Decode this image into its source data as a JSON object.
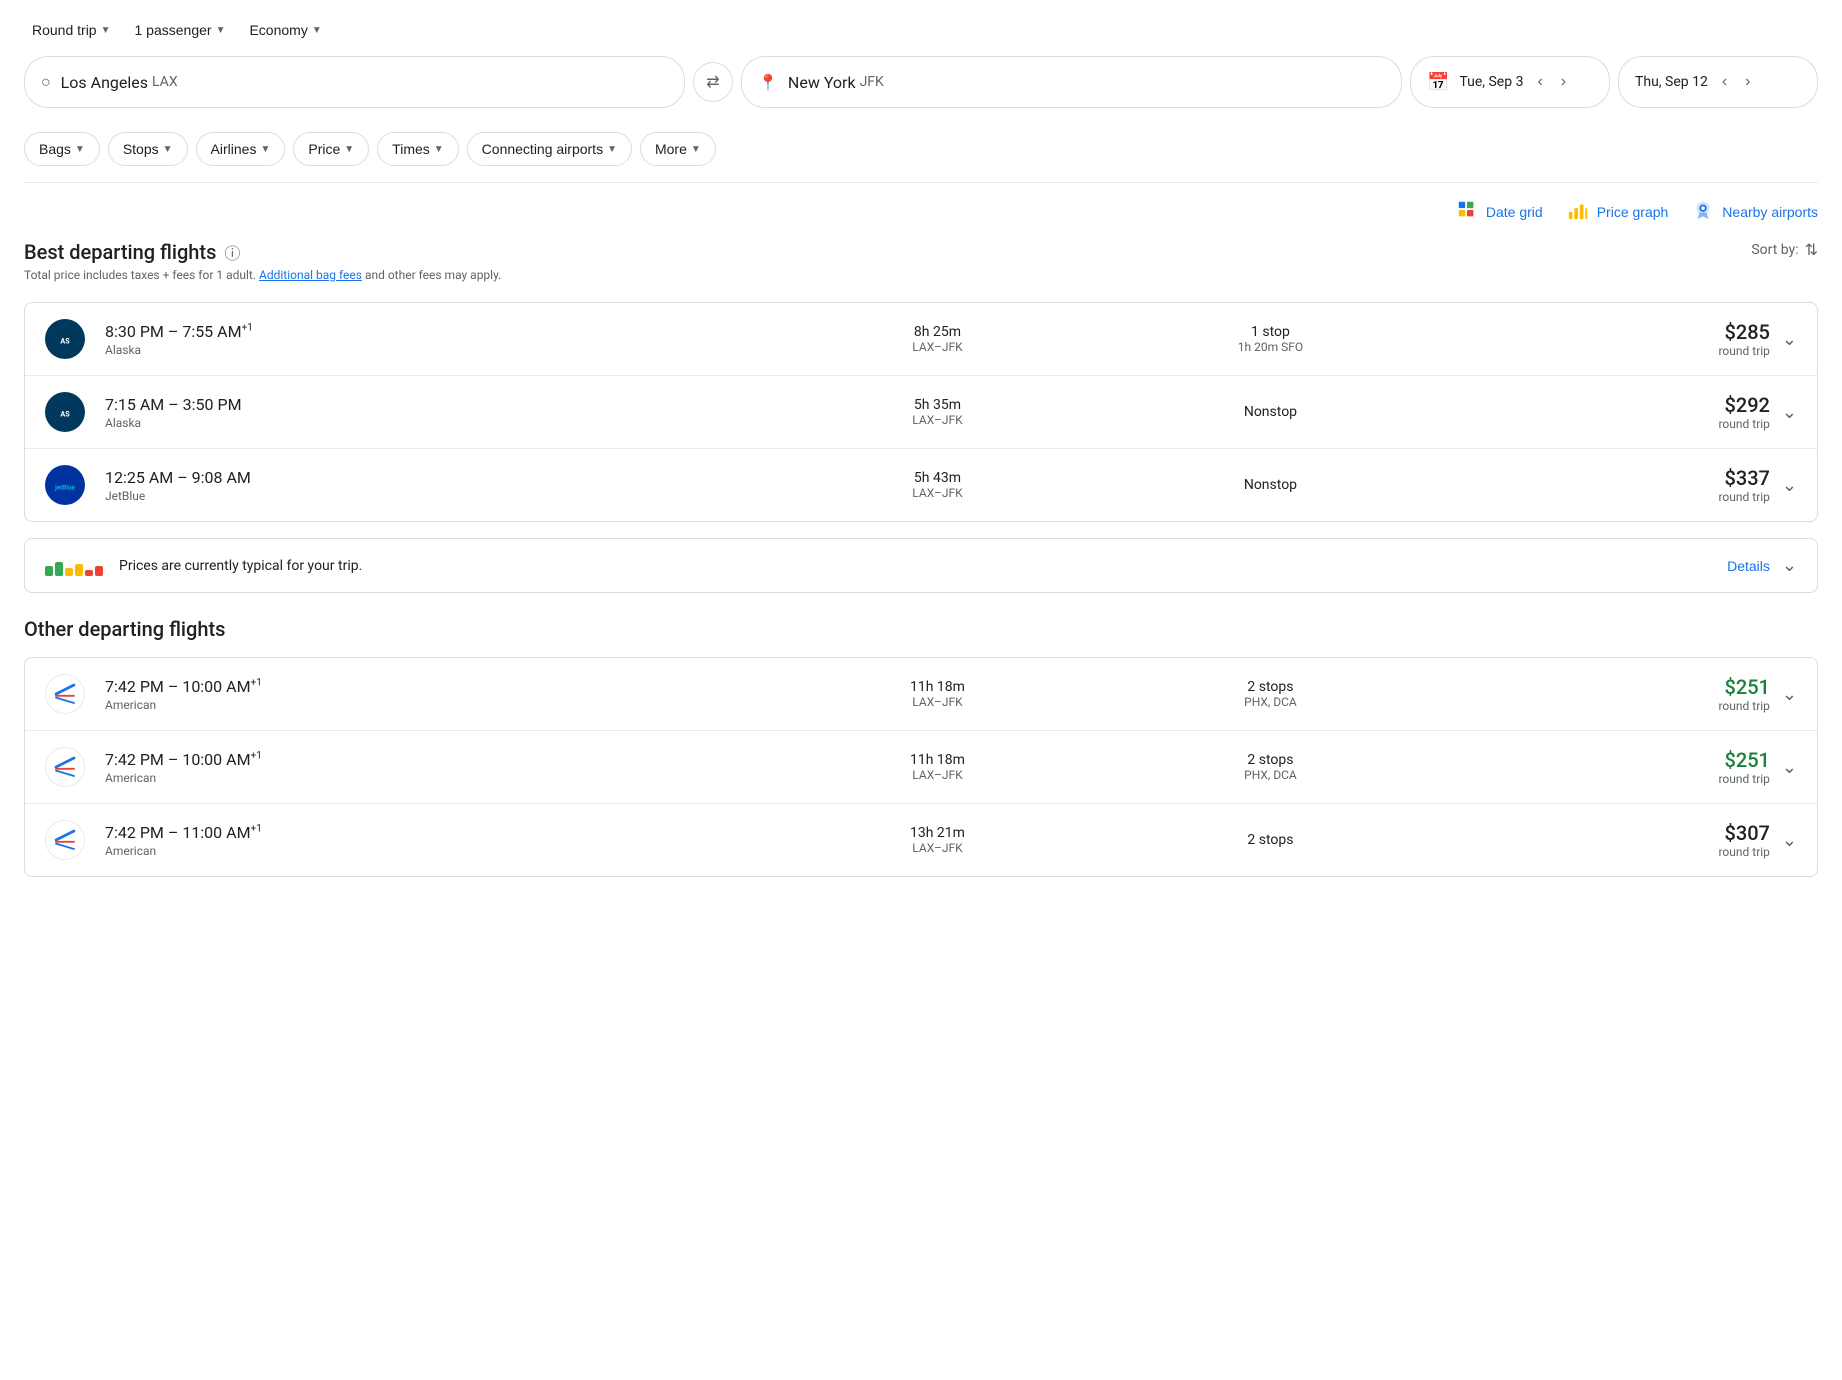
{
  "trip": {
    "type": "Round trip",
    "passengers": "1 passenger",
    "class": "Economy"
  },
  "search": {
    "origin": "Los Angeles",
    "origin_code": "LAX",
    "destination": "New York",
    "destination_code": "JFK",
    "depart_date": "Tue, Sep 3",
    "return_date": "Thu, Sep 12"
  },
  "filters": {
    "bags": "Bags",
    "stops": "Stops",
    "airlines": "Airlines",
    "price": "Price",
    "times": "Times",
    "connecting_airports": "Connecting airports",
    "more": "More"
  },
  "views": {
    "date_grid": "Date grid",
    "price_graph": "Price graph",
    "nearby_airports": "Nearby airports"
  },
  "best_flights": {
    "title": "Best departing flights",
    "subtitle": "Total price includes taxes + fees for 1 adult.",
    "additional_fees": "Additional bag fees",
    "subtitle2": "and other fees may apply.",
    "sort_label": "Sort by:",
    "flights": [
      {
        "airline": "Alaska",
        "time": "8:30 PM – 7:55 AM",
        "superscript": "+1",
        "duration": "8h 25m",
        "route": "LAX–JFK",
        "stops": "1 stop",
        "stop_detail": "1h 20m SFO",
        "price": "$285",
        "price_type": "round trip",
        "price_green": false
      },
      {
        "airline": "Alaska",
        "time": "7:15 AM – 3:50 PM",
        "superscript": "",
        "duration": "5h 35m",
        "route": "LAX–JFK",
        "stops": "Nonstop",
        "stop_detail": "",
        "price": "$292",
        "price_type": "round trip",
        "price_green": false
      },
      {
        "airline": "JetBlue",
        "time": "12:25 AM – 9:08 AM",
        "superscript": "",
        "duration": "5h 43m",
        "route": "LAX–JFK",
        "stops": "Nonstop",
        "stop_detail": "",
        "price": "$337",
        "price_type": "round trip",
        "price_green": false
      }
    ]
  },
  "price_info": {
    "text": "Prices are currently typical for your trip.",
    "details_label": "Details"
  },
  "other_flights": {
    "title": "Other departing flights",
    "flights": [
      {
        "airline": "American",
        "time": "7:42 PM – 10:00 AM",
        "superscript": "+1",
        "duration": "11h 18m",
        "route": "LAX–JFK",
        "stops": "2 stops",
        "stop_detail": "PHX, DCA",
        "price": "$251",
        "price_type": "round trip",
        "price_green": true
      },
      {
        "airline": "American",
        "time": "7:42 PM – 10:00 AM",
        "superscript": "+1",
        "duration": "11h 18m",
        "route": "LAX–JFK",
        "stops": "2 stops",
        "stop_detail": "PHX, DCA",
        "price": "$251",
        "price_type": "round trip",
        "price_green": true
      },
      {
        "airline": "American",
        "time": "7:42 PM – 11:00 AM",
        "superscript": "+1",
        "duration": "13h 21m",
        "route": "LAX–JFK",
        "stops": "2 stops",
        "stop_detail": "",
        "price": "$307",
        "price_type": "round trip",
        "price_green": false
      }
    ]
  }
}
